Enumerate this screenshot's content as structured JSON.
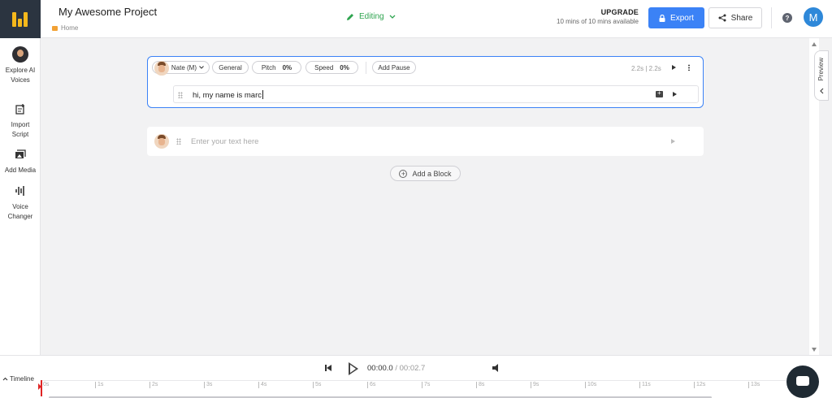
{
  "header": {
    "project_title": "My Awesome Project",
    "breadcrumb": "Home",
    "mode": "Editing",
    "upgrade_label": "UPGRADE",
    "usage_text": "10 mins of 10 mins available",
    "export_label": "Export",
    "share_label": "Share",
    "help_label": "?",
    "avatar_initial": "M"
  },
  "sidebar": {
    "items": [
      {
        "label1": "Explore AI",
        "label2": "Voices",
        "icon": "voice-avatar"
      },
      {
        "label1": "Import",
        "label2": "Script",
        "icon": "import-icon"
      },
      {
        "label1": "Add Media",
        "label2": "",
        "icon": "media-icon"
      },
      {
        "label1": "Voice",
        "label2": "Changer",
        "icon": "waveform-icon"
      }
    ]
  },
  "editor": {
    "block1": {
      "voice": "Nate (M)",
      "style": "General",
      "pitch_label": "Pitch",
      "pitch_value": "0%",
      "speed_label": "Speed",
      "speed_value": "0%",
      "add_pause": "Add Pause",
      "duration": "2.2s | 2.2s",
      "text": "hi, my name is marc"
    },
    "block2": {
      "placeholder": "Enter your text here"
    },
    "add_block": "Add a Block"
  },
  "preview": {
    "label": "Preview"
  },
  "player": {
    "current_time": "00:00.0",
    "separator": "/",
    "total_time": "00:02.7",
    "timeline_label": "Timeline",
    "ticks": [
      "0s",
      "1s",
      "2s",
      "3s",
      "4s",
      "5s",
      "6s",
      "7s",
      "8s",
      "9s",
      "10s",
      "11s",
      "12s",
      "13s"
    ]
  },
  "colors": {
    "accent": "#3b82f6",
    "editing": "#2ea44f",
    "logo_bg": "#2b3440",
    "logo_mark": "#f5b81c",
    "playhead": "#e02424"
  }
}
